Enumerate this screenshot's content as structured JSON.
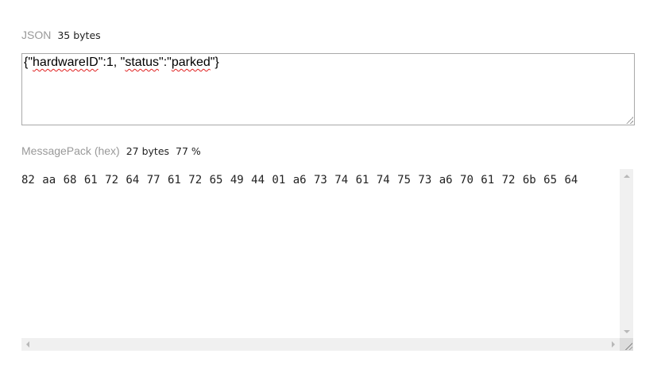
{
  "json_section": {
    "label": "JSON",
    "size": "35 bytes",
    "parts": [
      "{\"",
      "hardwareID",
      "\":1, \"",
      "status",
      "\":\"",
      "parked",
      "\"}"
    ]
  },
  "hex_section": {
    "label": "MessagePack (hex)",
    "size": "27 bytes",
    "ratio": "77 %",
    "value": "82 aa 68 61 72 64 77 61 72 65 49 44 01 a6 73 74 61 74 75 73 a6 70 61 72 6b 65 64"
  }
}
